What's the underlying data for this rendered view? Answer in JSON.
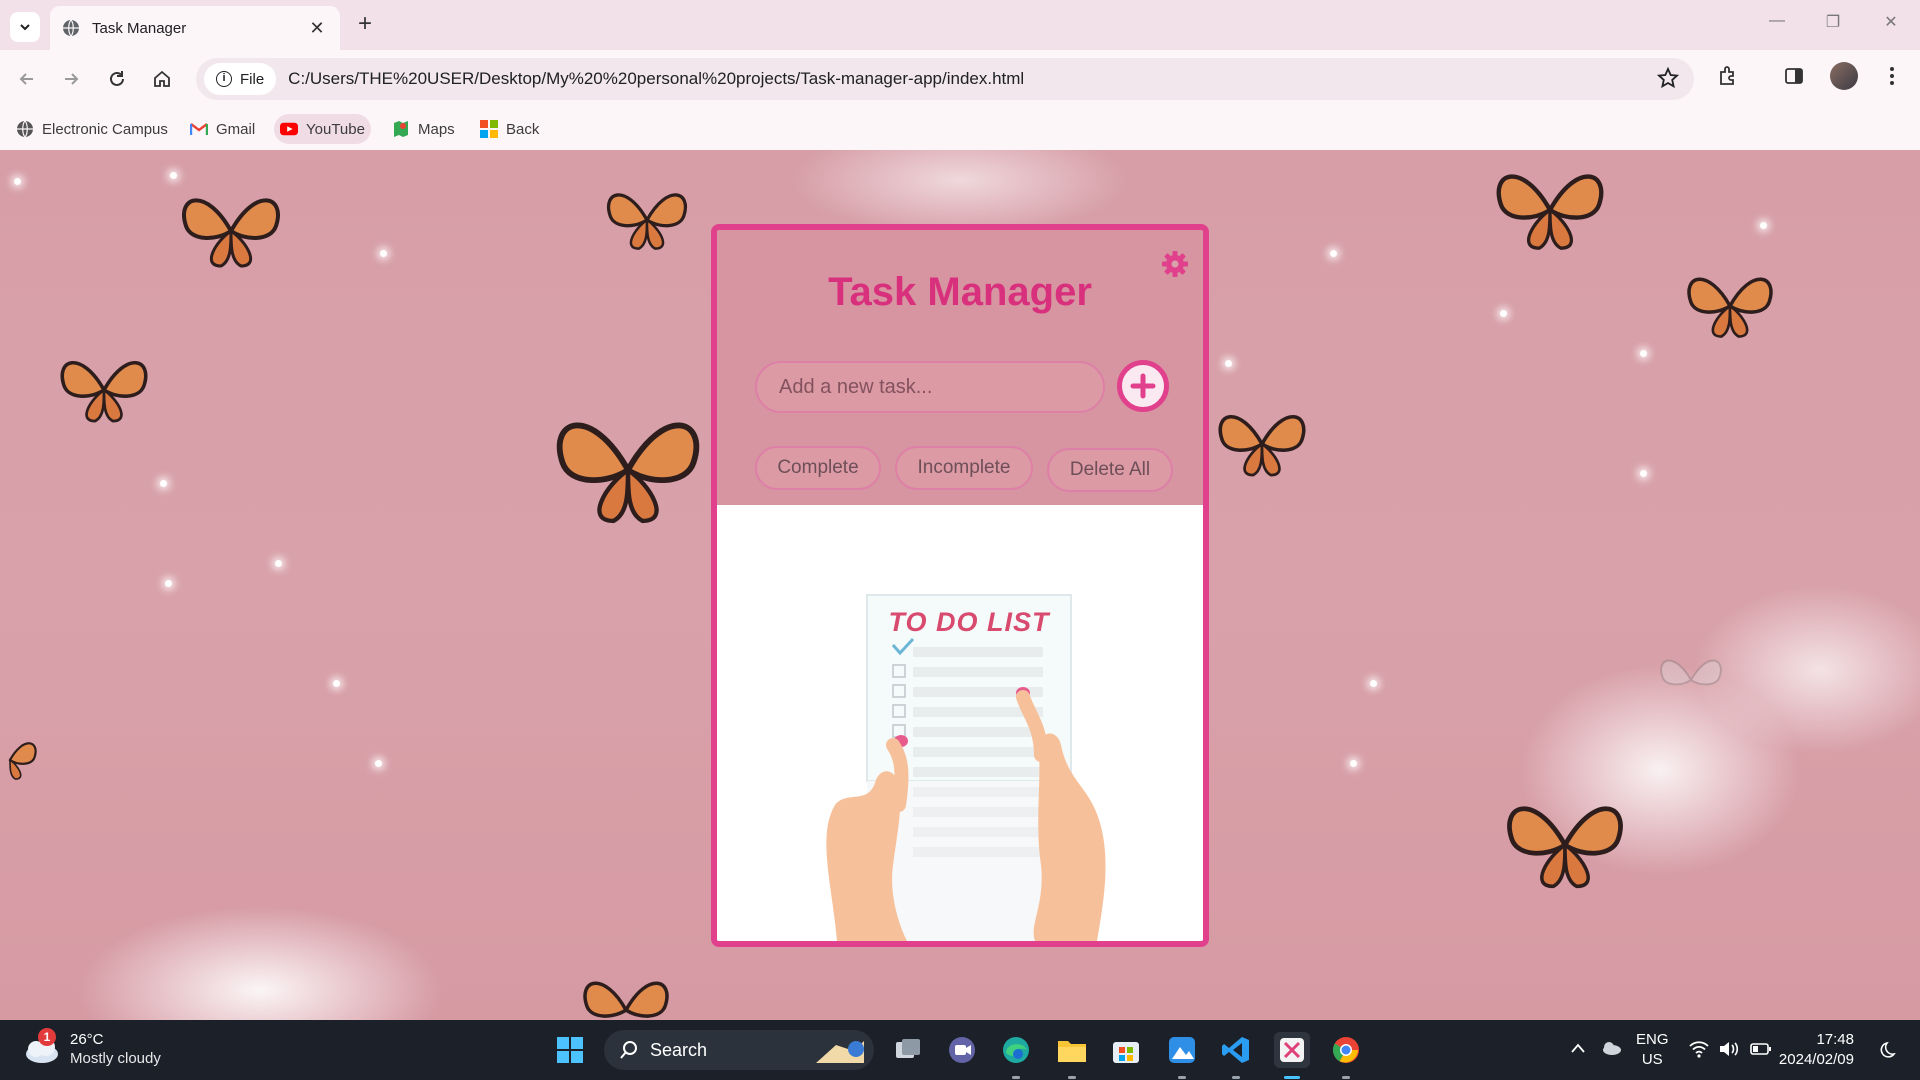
{
  "browser": {
    "tab_title": "Task Manager",
    "new_tab": "+",
    "chip_label": "File",
    "url": "C:/Users/THE%20USER/Desktop/My%20%20personal%20projects/Task-manager-app/index.html"
  },
  "bookmarks": [
    {
      "label": "Electronic Campus",
      "icon": "globe-icon"
    },
    {
      "label": "Gmail",
      "icon": "gmail-icon"
    },
    {
      "label": "YouTube",
      "icon": "youtube-icon"
    },
    {
      "label": "Maps",
      "icon": "maps-icon"
    },
    {
      "label": "Back",
      "icon": "windows-icon"
    }
  ],
  "app": {
    "title": "Task Manager",
    "input_placeholder": "Add a new task...",
    "buttons": {
      "complete": "Complete",
      "incomplete": "Incomplete",
      "delete_all": "Delete All"
    },
    "illustration_text": "TO DO LIST",
    "accent_color": "#e1408c"
  },
  "taskbar": {
    "weather_badge": "1",
    "temperature": "26°C",
    "condition": "Mostly cloudy",
    "search_label": "Search",
    "lang_top": "ENG",
    "lang_bottom": "US",
    "time": "17:48",
    "date": "2024/02/09"
  }
}
